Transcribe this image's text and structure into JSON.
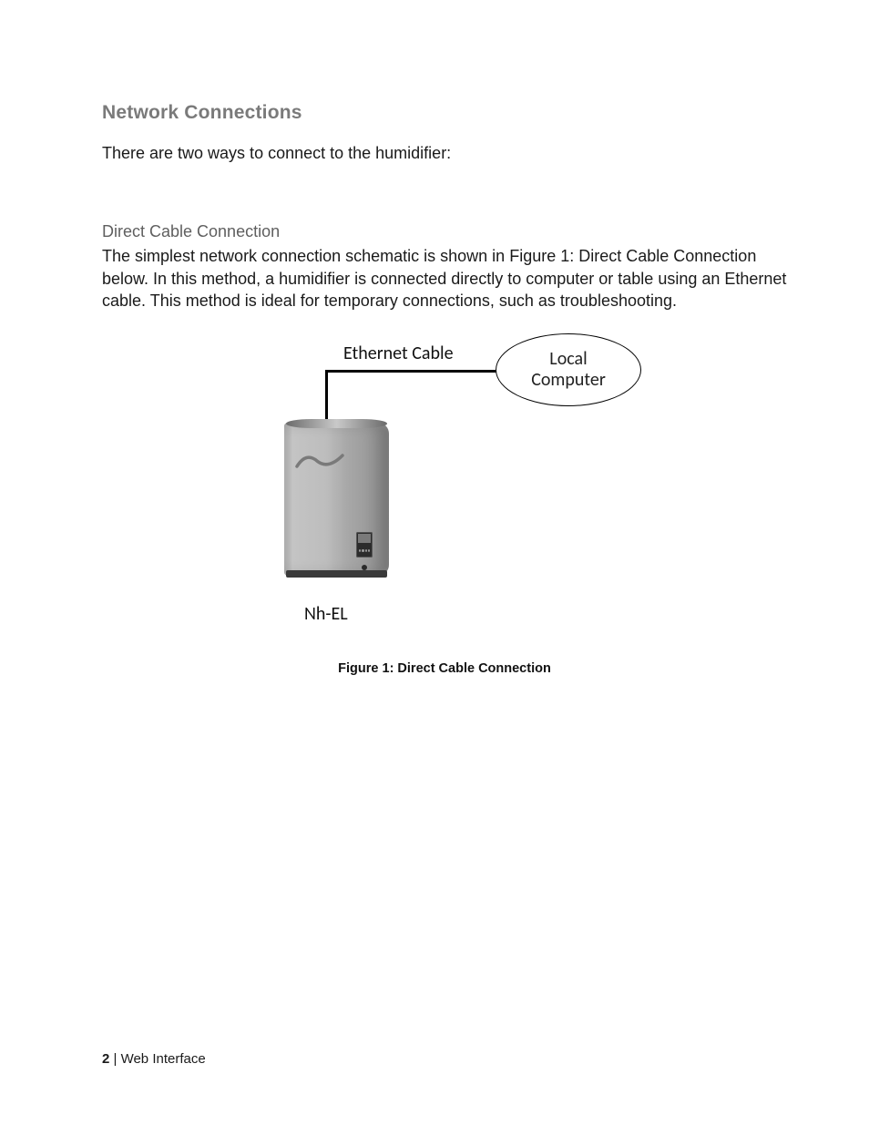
{
  "heading": "Network Connections",
  "intro": "There are two ways to connect to the humidifier:",
  "subsection": {
    "title": "Direct Cable Connection",
    "body": "The simplest network connection schematic is shown in Figure 1: Direct Cable Connection below.  In this method, a humidifier is connected directly to computer or table using an Ethernet cable.  This method is ideal for temporary connections, such as troubleshooting."
  },
  "figure": {
    "ethernet_label": "Ethernet Cable",
    "node_line1": "Local",
    "node_line2": "Computer",
    "device_label": "Nh-EL",
    "caption": "Figure 1: Direct Cable Connection"
  },
  "footer": {
    "page_number": "2",
    "separator": " | ",
    "section": "Web Interface"
  }
}
